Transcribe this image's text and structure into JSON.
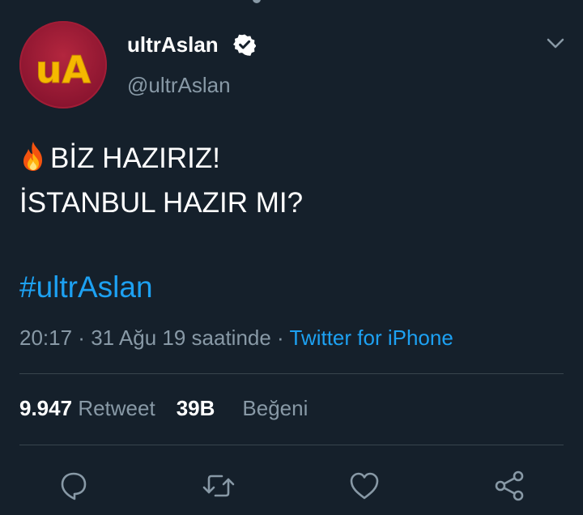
{
  "tweet": {
    "display_name": "ultrAslan",
    "handle": "@ultrAslan",
    "avatar_text": "uA",
    "verified_icon": "verified-badge-icon",
    "text_line_1": "BİZ HAZIRIZ!",
    "text_line_1_emoji": "fire-emoji",
    "text_line_2": "İSTANBUL HAZIR MI?",
    "hashtag": "#ultrAslan",
    "time": "20:17",
    "separator_1": " · ",
    "date": "31 Ağu 19 saatinde",
    "separator_2": " · ",
    "source": "Twitter for iPhone"
  },
  "stats": {
    "retweet_count": "9.947",
    "retweet_label": "Retweet",
    "like_count": "39B",
    "like_label": "Beğeni"
  },
  "actions": {
    "reply_icon": "reply-icon",
    "retweet_icon": "retweet-icon",
    "like_icon": "heart-icon",
    "share_icon": "share-icon"
  },
  "colors": {
    "background": "#15202b",
    "primary_text": "#ffffff",
    "secondary_text": "#8899a6",
    "accent": "#1da1f2",
    "divider": "#38444d",
    "avatar_bg": "#a11d36",
    "avatar_text": "#f5b800"
  }
}
